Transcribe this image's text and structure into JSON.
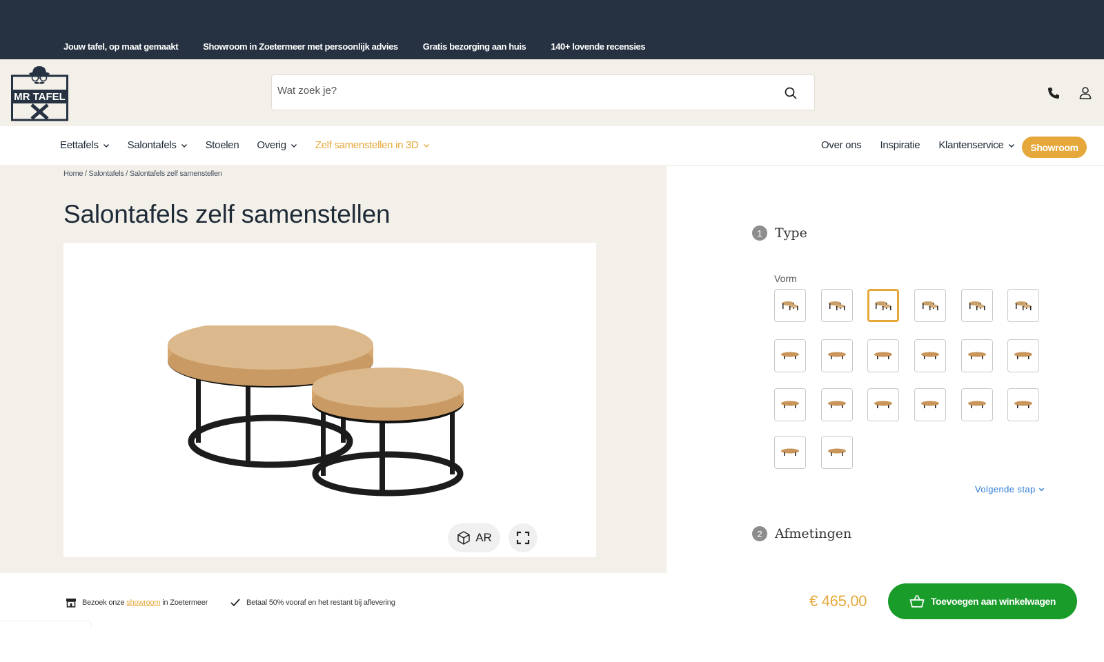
{
  "usp_bar": {
    "items": [
      "Jouw tafel, op maat gemaakt",
      "Showroom in Zoetermeer met persoonlijk advies",
      "Gratis bezorging aan huis",
      "140+ lovende recensies"
    ]
  },
  "header": {
    "logo_text": "MR TAFEL",
    "search_placeholder": "Wat zoek je?"
  },
  "nav": {
    "left": [
      "Eettafels",
      "Salontafels",
      "Stoelen",
      "Overig",
      "Zelf samenstellen in 3D"
    ],
    "right": [
      "Over ons",
      "Inspiratie",
      "Klantenservice"
    ],
    "showroom_label": "Showroom"
  },
  "breadcrumb": "Home / Salontafels / Salontafels zelf samenstellen",
  "page_title": "Salontafels zelf samenstellen",
  "viewer": {
    "ar_label": "AR"
  },
  "configurator": {
    "step1": {
      "number": "1",
      "title": "Type"
    },
    "vorm_label": "Vorm",
    "selected_option_index": 2,
    "option_count": 20,
    "next_step_label": "Volgende stap",
    "step2": {
      "number": "2",
      "title": "Afmetingen"
    }
  },
  "footer": {
    "visit_prefix": "Bezoek onze",
    "visit_link": "showroom",
    "visit_suffix": "in Zoetermeer",
    "payment_note": "Betaal 50% vooraf en het restant bij aflevering",
    "price": "€ 465,00",
    "add_to_cart_label": "Toevoegen aan winkelwagen"
  },
  "colors": {
    "topbar": "#263241",
    "accent": "#e6a83a",
    "cart_green": "#1a9c2b",
    "panel_bg": "#f3f0ea"
  }
}
